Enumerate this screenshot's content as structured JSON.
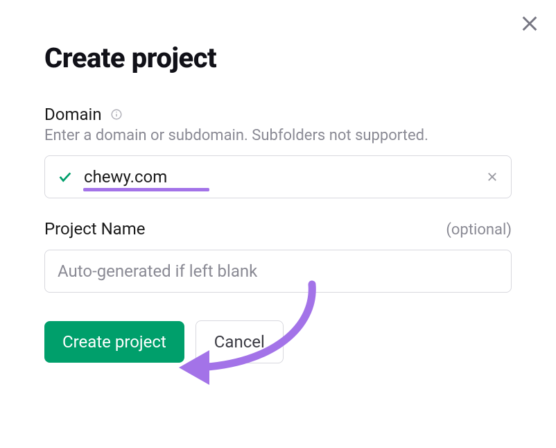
{
  "modal": {
    "title": "Create project",
    "domain_field": {
      "label": "Domain",
      "helper": "Enter a domain or subdomain. Subfolders not supported.",
      "value": "chewy.com"
    },
    "project_name_field": {
      "label": "Project Name",
      "optional_label": "(optional)",
      "placeholder": "Auto-generated if left blank",
      "value": ""
    },
    "buttons": {
      "create": "Create project",
      "cancel": "Cancel"
    }
  },
  "colors": {
    "primary_green": "#009f6b",
    "accent_purple": "#a373e8",
    "text_muted": "#8a8a94"
  }
}
